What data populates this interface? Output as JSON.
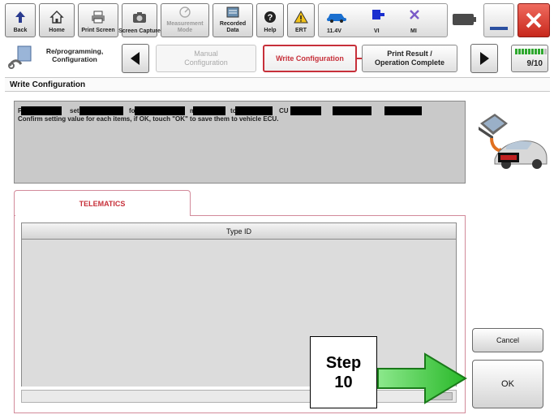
{
  "toolbar": {
    "buttons": [
      {
        "label": "Back",
        "icon": "back-arrow-icon"
      },
      {
        "label": "Home",
        "icon": "home-icon"
      },
      {
        "label": "Print Screen",
        "icon": "printer-icon"
      },
      {
        "label": "Screen Capture",
        "icon": "camera-icon"
      },
      {
        "label": "Measurement Mode",
        "icon": "measurement-icon"
      },
      {
        "label": "Recorded Data",
        "icon": "recorded-data-icon"
      },
      {
        "label": "Help",
        "icon": "help-icon"
      },
      {
        "label": "ERT",
        "icon": "warning-icon"
      }
    ],
    "status": {
      "voltage": "11.4V",
      "vi": "VI",
      "mi": "MI"
    },
    "colors": {
      "close": "#d9342b",
      "battery": "#2fa82f"
    }
  },
  "nav": {
    "home_label": "Re/programming, Configuration",
    "steps": [
      {
        "label": "Manual Configuration",
        "state": "inactive"
      },
      {
        "label": "Write Configuration",
        "state": "active"
      },
      {
        "label": "Print Result / Operation Complete",
        "state": "next"
      }
    ],
    "progress_text": "9/10",
    "progress_fraction": 0.9
  },
  "page": {
    "title": "Write Configuration"
  },
  "message": {
    "line1_fragments": [
      "P",
      "set",
      "fo",
      "m",
      "to",
      "CU"
    ],
    "line2": "Confirm setting value for each items, if OK, touch \"OK\" to save them to vehicle ECU."
  },
  "tab": {
    "label": "TELEMATICS"
  },
  "table": {
    "column_header": "Type ID",
    "rows": []
  },
  "buttons": {
    "cancel": "Cancel",
    "ok": "OK"
  },
  "annotation": {
    "step_word": "Step",
    "step_number": "10",
    "arrow_color": "#39d039"
  }
}
